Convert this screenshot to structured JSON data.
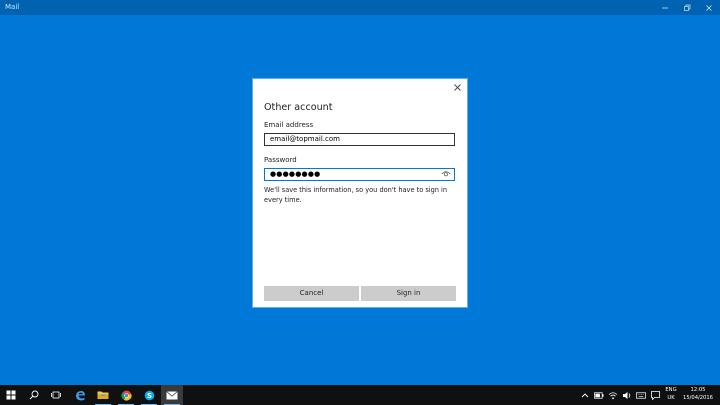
{
  "window": {
    "title": "Mail"
  },
  "dialog": {
    "heading": "Other account",
    "email_label": "Email address",
    "email_value": "email@topmail.com",
    "password_label": "Password",
    "password_masked": "●●●●●●●●",
    "notice": "We'll save this information, so you don't have to sign in every time.",
    "cancel_label": "Cancel",
    "signin_label": "Sign in"
  },
  "taskbar": {
    "apps": [
      "start-icon",
      "search-icon",
      "task-view-icon",
      "edge-icon",
      "file-explorer-icon",
      "chrome-icon",
      "skype-icon",
      "mail-icon"
    ],
    "language": [
      "ENG",
      "UK"
    ],
    "time": "12:05",
    "date": "15/04/2016"
  },
  "colors": {
    "desktop": "#0078d7",
    "titlebar": "#0063b1",
    "taskbar": "#101010",
    "focus": "#0078d7"
  }
}
